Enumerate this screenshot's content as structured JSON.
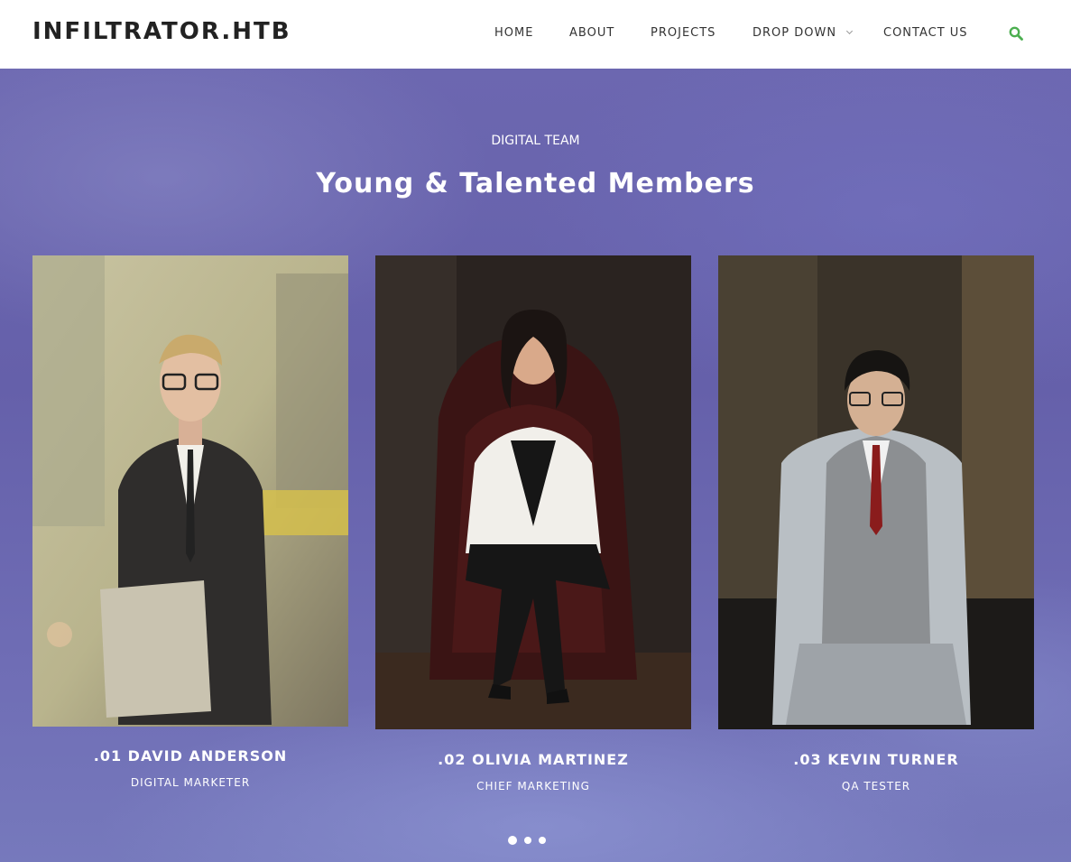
{
  "header": {
    "logo": "INFILTRATOR.HTB",
    "nav": {
      "home": "HOME",
      "about": "ABOUT",
      "projects": "PROJECTS",
      "dropdown": "DROP DOWN",
      "contact": "CONTACT US"
    },
    "search_icon": "search-icon",
    "accent_color": "#4caf50"
  },
  "hero": {
    "eyebrow": "DIGITAL TEAM",
    "title": "Young & Talented Members"
  },
  "team": [
    {
      "name": ".01 DAVID ANDERSON",
      "role": "DIGITAL MARKETER"
    },
    {
      "name": ".02 OLIVIA MARTINEZ",
      "role": "CHIEF MARKETING"
    },
    {
      "name": ".03 KEVIN TURNER",
      "role": "QA TESTER"
    }
  ],
  "carousel": {
    "pages": 3,
    "active": 1
  }
}
